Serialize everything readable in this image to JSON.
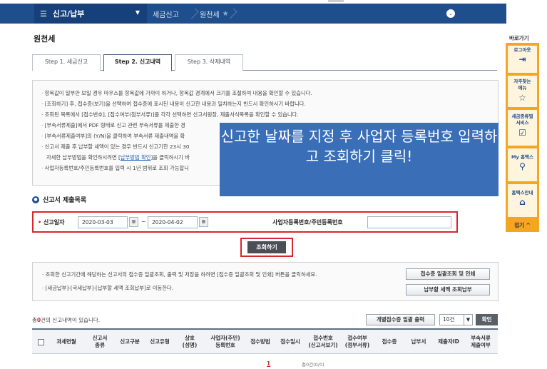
{
  "nav": {
    "menu_label": "신고/납부",
    "crumb1": "세금신고",
    "crumb2": "원천세"
  },
  "page_title": "원천세",
  "tabs": [
    "Step 1. 세금신고",
    "Step 2. 신고내역",
    "Step 3. 삭제내역"
  ],
  "info_lines": [
    "항목값이 일부만 보일 경우 마우스를 항목값에 가까이 하거나, 항목값 경계에서 크기를 조절하여 내용을 확인할 수 있습니다.",
    "[조회하기] 후, 접수증(보기)을 선택하여 접수증에 표시된 내용이 신고한 내용과 일치하는지 반드시 확인하시기 바랍니다.",
    "조회된 목록에서 [접수번호], [접수여부(첨부서류)]를 각각 선택하면 신고서원장, 제출서식목록을 확인할 수 있습니다.",
    "[부속서류제출]에서 PDF 형태로 신고 관련 부속서류를 제출한 경",
    "[부속서류제출여부]의 (Y/N)을 클릭하여 부속서류 제출내역을 확",
    "신고서 제출 후 납부할 세액이 있는 경우 반드시 신고기한 23시 30"
  ],
  "info_sub_prefix": "자세한 납부방법을 확인하시려면 [",
  "info_sub_link": "납부방법 확인",
  "info_sub_suffix": "]을 클릭하시기 바",
  "info_last": "사업자등록번호/주민등록번호를 입력 시 1년 범위로 조회 가능합니",
  "overlay_text": "신고한 날짜를 지정 후 사업자 등록번호 입력하고 조회하기 클릭!",
  "section_title": "신고서 제출목록",
  "search": {
    "date_label": "신고일자",
    "date_from": "2020-03-03",
    "date_to": "2020-04-02",
    "tilde": "~",
    "reg_label": "사업자등록번호/주민등록번호",
    "reg_value": "",
    "search_button": "조회하기"
  },
  "info2": {
    "line1": "· 조회한 신고기간에 해당하는 신고서의 접수증 일괄조회, 출력 및 저장을 하려면 [접수증 일괄조회 및 인쇄] 버튼을 클릭하세요.",
    "line2": "· [세금납부]-[국세납부]-[납부할 세액 조회납부]로 이동한다.",
    "btn1": "접수증 일괄조회 및 인쇄",
    "btn2": "납부할 세액 조회납부"
  },
  "count": {
    "prefix": "총",
    "num": "0",
    "suffix": "건의 신고내역이 있습니다."
  },
  "tools": {
    "bulk_print": "개별접수증 일괄 출력",
    "page_size": "10건",
    "ok": "확인"
  },
  "table_headers": [
    "과세연월",
    "신고서\n종류",
    "신고구분",
    "신고유형",
    "상호\n(성명)",
    "사업자(주민)\n등록번호",
    "접수방법",
    "접수일시",
    "접수번호\n(신고서보기)",
    "접수여부\n(첨부서류)",
    "접수증",
    "납부서",
    "제출자ID",
    "부속서류\n제출여부"
  ],
  "pager": {
    "current": "1",
    "info": "총0건(0/0)"
  },
  "quick": {
    "title": "바로가기",
    "items": [
      "로그아웃",
      "자주찾는\n메뉴",
      "세금종류별\n서비스",
      "My 홈택스",
      "홈택스안내"
    ],
    "icons": [
      "logout-icon",
      "star-icon",
      "checkbox-icon",
      "person-icon",
      "home-icon"
    ],
    "close": "접기 ^"
  },
  "colors": {
    "nav": "#1f4e8c",
    "accent": "#d9262e",
    "quick": "#f4a623",
    "overlay": "#3a6fb8"
  }
}
